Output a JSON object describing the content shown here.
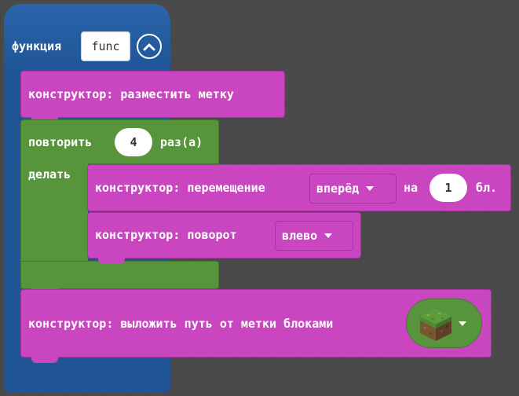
{
  "function_block": {
    "keyword": "функция",
    "name": "func",
    "collapse_icon": "chevron-up-circle-icon"
  },
  "place_marker": {
    "label": "конструктор: разместить метку"
  },
  "repeat": {
    "prefix": "повторить",
    "count": "4",
    "suffix": "раз(а)",
    "do_label": "делать"
  },
  "move": {
    "label": "конструктор: перемещение",
    "direction": "вперёд",
    "on_label": "на",
    "distance": "1",
    "unit": "бл."
  },
  "turn": {
    "label": "конструктор: поворот",
    "direction": "влево"
  },
  "path": {
    "label": "конструктор: выложить путь от метки блоками",
    "block_icon": "grass-block-icon"
  },
  "colors": {
    "function": "#1f5597",
    "builder": "#c946c0",
    "loop": "#57943c",
    "background": "#4a4a4a"
  }
}
